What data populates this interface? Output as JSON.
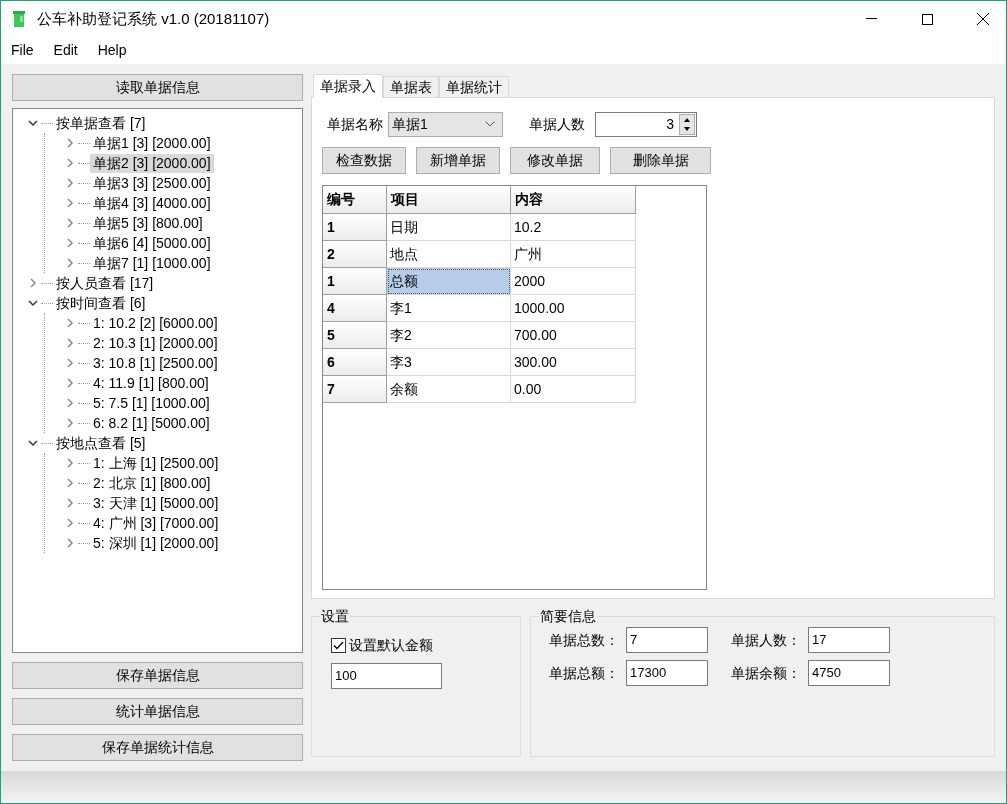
{
  "window": {
    "title": "公车补助登记系统 v1.0 (20181107)"
  },
  "menu": [
    "File",
    "Edit",
    "Help"
  ],
  "left_buttons_top": [
    "读取单据信息"
  ],
  "tree": [
    {
      "label": "按单据查看 [7]",
      "expanded": true,
      "selected": false,
      "children": [
        {
          "label": "单据1 [3] [2000.00]",
          "expanded": false,
          "selected": false
        },
        {
          "label": "单据2 [3] [2000.00]",
          "expanded": false,
          "selected": true
        },
        {
          "label": "单据3 [3] [2500.00]",
          "expanded": false,
          "selected": false
        },
        {
          "label": "单据4 [3] [4000.00]",
          "expanded": false,
          "selected": false
        },
        {
          "label": "单据5 [3] [800.00]",
          "expanded": false,
          "selected": false
        },
        {
          "label": "单据6 [4] [5000.00]",
          "expanded": false,
          "selected": false
        },
        {
          "label": "单据7 [1] [1000.00]",
          "expanded": false,
          "selected": false
        }
      ]
    },
    {
      "label": "按人员查看 [17]",
      "expanded": false,
      "selected": false
    },
    {
      "label": "按时间查看 [6]",
      "expanded": true,
      "selected": false,
      "children": [
        {
          "label": "1: 10.2 [2] [6000.00]",
          "expanded": false,
          "selected": false
        },
        {
          "label": "2: 10.3 [1] [2000.00]",
          "expanded": false,
          "selected": false
        },
        {
          "label": "3: 10.8 [1] [2500.00]",
          "expanded": false,
          "selected": false
        },
        {
          "label": "4: 11.9 [1] [800.00]",
          "expanded": false,
          "selected": false
        },
        {
          "label": "5: 7.5 [1] [1000.00]",
          "expanded": false,
          "selected": false
        },
        {
          "label": "6: 8.2 [1] [5000.00]",
          "expanded": false,
          "selected": false
        }
      ]
    },
    {
      "label": "按地点查看 [5]",
      "expanded": true,
      "selected": false,
      "children": [
        {
          "label": "1: 上海 [1] [2500.00]",
          "expanded": false,
          "selected": false
        },
        {
          "label": "2: 北京 [1] [800.00]",
          "expanded": false,
          "selected": false
        },
        {
          "label": "3: 天津 [1] [5000.00]",
          "expanded": false,
          "selected": false
        },
        {
          "label": "4: 广州 [3] [7000.00]",
          "expanded": false,
          "selected": false
        },
        {
          "label": "5: 深圳 [1] [2000.00]",
          "expanded": false,
          "selected": false
        }
      ]
    }
  ],
  "left_buttons_bottom": [
    "保存单据信息",
    "统计单据信息",
    "保存单据统计信息"
  ],
  "tabs": [
    {
      "label": "单据录入",
      "selected": true
    },
    {
      "label": "单据表",
      "selected": false
    },
    {
      "label": "单据统计",
      "selected": false
    }
  ],
  "form": {
    "name_label": "单据名称",
    "name_value": "单据1",
    "count_label": "单据人数",
    "count_value": "3"
  },
  "actions": [
    "检查数据",
    "新增单据",
    "修改单据",
    "删除单据"
  ],
  "table": {
    "columns": [
      "编号",
      "项目",
      "内容"
    ],
    "rows": [
      {
        "id": "1",
        "item": "日期",
        "content": "10.2",
        "selected": false
      },
      {
        "id": "2",
        "item": "地点",
        "content": "广州",
        "selected": false
      },
      {
        "id": "1",
        "item": "总额",
        "content": "2000",
        "selected": true
      },
      {
        "id": "4",
        "item": "李1",
        "content": "1000.00",
        "selected": false
      },
      {
        "id": "5",
        "item": "李2",
        "content": "700.00",
        "selected": false
      },
      {
        "id": "6",
        "item": "李3",
        "content": "300.00",
        "selected": false
      },
      {
        "id": "7",
        "item": "余额",
        "content": "0.00",
        "selected": false
      }
    ]
  },
  "settings": {
    "title": "设置",
    "checkbox_label": "设置默认金额",
    "checked": true,
    "amount": "100"
  },
  "summary": {
    "title": "简要信息",
    "fields": [
      {
        "label": "单据总数：",
        "value": "7"
      },
      {
        "label": "单据人数：",
        "value": "17"
      },
      {
        "label": "单据总额：",
        "value": "17300"
      },
      {
        "label": "单据余额：",
        "value": "4750"
      }
    ]
  }
}
